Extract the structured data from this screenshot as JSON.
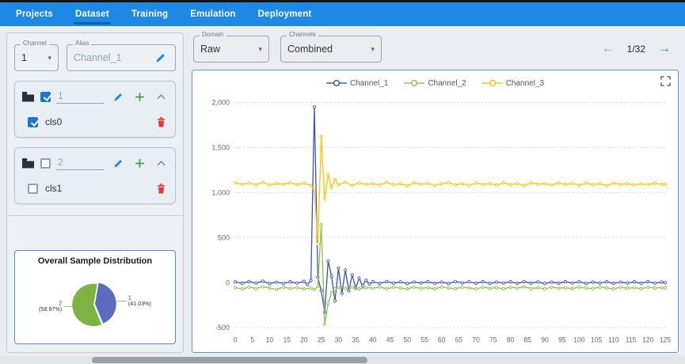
{
  "nav": {
    "tabs": [
      {
        "label": "Projects"
      },
      {
        "label": "Dataset"
      },
      {
        "label": "Training"
      },
      {
        "label": "Emulation"
      },
      {
        "label": "Deployment"
      }
    ],
    "active_tab": "Dataset"
  },
  "icons": {
    "caret": "▾",
    "arrow_left": "←",
    "arrow_right": "→"
  },
  "colors": {
    "nav_bg": "#1e88e5",
    "accent": "#1e88e5",
    "danger": "#e53935",
    "channel1": "#3f51b5",
    "channel2": "#8bc34a",
    "channel3": "#ffc107"
  },
  "left_panel": {
    "channel_field": {
      "label": "Channel",
      "value": "1"
    },
    "alias_field": {
      "label": "Alias",
      "value": "Channel_1"
    },
    "groups": [
      {
        "name": "1",
        "checked": true,
        "items": [
          {
            "label": "cls0",
            "checked": true
          }
        ]
      },
      {
        "name": "2",
        "checked": false,
        "items": [
          {
            "label": "cls1",
            "checked": false
          }
        ]
      }
    ],
    "distribution": {
      "title": "Overall Sample Distribution",
      "slices": [
        {
          "label": "1",
          "pct_label": "(41.03%)",
          "value": 41.03,
          "color": "#5c6bc0"
        },
        {
          "label": "2",
          "pct_label": "(58.97%)",
          "value": 58.97,
          "color": "#7cb342"
        }
      ]
    }
  },
  "toolbar": {
    "domain_field": {
      "label": "Domain",
      "value": "Raw"
    },
    "channels_field": {
      "label": "Channels",
      "value": "Combined"
    },
    "pager": {
      "text": "1/32"
    }
  },
  "chart_data": {
    "type": "line",
    "title": "",
    "xlabel": "",
    "ylabel": "",
    "xlim": [
      0,
      125
    ],
    "ylim": [
      -500,
      2000
    ],
    "yticks": [
      -500,
      0,
      500,
      1000,
      1500,
      2000
    ],
    "xtick_step": 5,
    "grid": "horizontal-dashed",
    "legend_position": "top-center",
    "series": [
      {
        "name": "Channel_1",
        "color": "#3f51b5",
        "points": [
          [
            0,
            8
          ],
          [
            2,
            -6
          ],
          [
            4,
            12
          ],
          [
            6,
            -4
          ],
          [
            8,
            15
          ],
          [
            10,
            -10
          ],
          [
            12,
            5
          ],
          [
            14,
            -8
          ],
          [
            16,
            10
          ],
          [
            18,
            -5
          ],
          [
            20,
            14
          ],
          [
            21,
            -20
          ],
          [
            22,
            25
          ],
          [
            23,
            1950
          ],
          [
            24,
            60
          ],
          [
            25,
            -90
          ],
          [
            26,
            -330
          ],
          [
            27,
            240
          ],
          [
            28,
            70
          ],
          [
            29,
            -200
          ],
          [
            30,
            160
          ],
          [
            31,
            -120
          ],
          [
            32,
            140
          ],
          [
            33,
            -90
          ],
          [
            34,
            85
          ],
          [
            35,
            -60
          ],
          [
            36,
            50
          ],
          [
            37,
            -35
          ],
          [
            38,
            25
          ],
          [
            39,
            -15
          ],
          [
            40,
            10
          ],
          [
            42,
            -8
          ],
          [
            44,
            12
          ],
          [
            46,
            -5
          ],
          [
            48,
            8
          ],
          [
            50,
            -10
          ],
          [
            52,
            6
          ],
          [
            54,
            -4
          ],
          [
            56,
            10
          ],
          [
            58,
            -7
          ],
          [
            60,
            5
          ],
          [
            62,
            -9
          ],
          [
            64,
            12
          ],
          [
            66,
            -4
          ],
          [
            68,
            8
          ],
          [
            70,
            -6
          ],
          [
            72,
            10
          ],
          [
            74,
            -8
          ],
          [
            76,
            5
          ],
          [
            78,
            -4
          ],
          [
            80,
            9
          ],
          [
            82,
            -7
          ],
          [
            84,
            12
          ],
          [
            86,
            -5
          ],
          [
            88,
            7
          ],
          [
            90,
            -9
          ],
          [
            92,
            5
          ],
          [
            94,
            -6
          ],
          [
            96,
            10
          ],
          [
            98,
            -4
          ],
          [
            100,
            8
          ],
          [
            102,
            -8
          ],
          [
            104,
            6
          ],
          [
            106,
            -5
          ],
          [
            108,
            9
          ],
          [
            110,
            -7
          ],
          [
            112,
            5
          ],
          [
            114,
            -4
          ],
          [
            116,
            8
          ],
          [
            118,
            -6
          ],
          [
            120,
            10
          ],
          [
            122,
            -5
          ],
          [
            124,
            6
          ],
          [
            125,
            0
          ]
        ]
      },
      {
        "name": "Channel_2",
        "color": "#8bc34a",
        "points": [
          [
            0,
            -55
          ],
          [
            2,
            -70
          ],
          [
            4,
            -50
          ],
          [
            6,
            -65
          ],
          [
            8,
            -45
          ],
          [
            10,
            -60
          ],
          [
            12,
            -75
          ],
          [
            14,
            -50
          ],
          [
            16,
            -65
          ],
          [
            18,
            -55
          ],
          [
            20,
            -70
          ],
          [
            22,
            -60
          ],
          [
            23,
            -80
          ],
          [
            24,
            -40
          ],
          [
            25,
            640
          ],
          [
            26,
            -460
          ],
          [
            27,
            -230
          ],
          [
            28,
            -110
          ],
          [
            29,
            -70
          ],
          [
            30,
            -55
          ],
          [
            32,
            -65
          ],
          [
            34,
            -50
          ],
          [
            36,
            -70
          ],
          [
            38,
            -55
          ],
          [
            40,
            -62
          ],
          [
            42,
            -48
          ],
          [
            44,
            -68
          ],
          [
            46,
            -52
          ],
          [
            48,
            -60
          ],
          [
            50,
            -70
          ],
          [
            52,
            -50
          ],
          [
            54,
            -64
          ],
          [
            56,
            -55
          ],
          [
            58,
            -70
          ],
          [
            60,
            -48
          ],
          [
            62,
            -60
          ],
          [
            64,
            -66
          ],
          [
            66,
            -52
          ],
          [
            68,
            -58
          ],
          [
            70,
            -70
          ],
          [
            72,
            -50
          ],
          [
            74,
            -64
          ],
          [
            76,
            -55
          ],
          [
            78,
            -68
          ],
          [
            80,
            -52
          ],
          [
            82,
            -60
          ],
          [
            84,
            -45
          ],
          [
            86,
            -66
          ],
          [
            88,
            -55
          ],
          [
            90,
            -70
          ],
          [
            92,
            -50
          ],
          [
            94,
            -62
          ],
          [
            96,
            -56
          ],
          [
            98,
            -68
          ],
          [
            100,
            -48
          ],
          [
            102,
            -60
          ],
          [
            104,
            -65
          ],
          [
            106,
            -52
          ],
          [
            108,
            -58
          ],
          [
            110,
            -70
          ],
          [
            112,
            -50
          ],
          [
            114,
            -63
          ],
          [
            116,
            -55
          ],
          [
            118,
            -67
          ],
          [
            120,
            -52
          ],
          [
            122,
            -60
          ],
          [
            124,
            -56
          ],
          [
            125,
            -58
          ]
        ]
      },
      {
        "name": "Channel_3",
        "color": "#ffc107",
        "points": [
          [
            0,
            1110
          ],
          [
            2,
            1090
          ],
          [
            4,
            1105
          ],
          [
            6,
            1088
          ],
          [
            8,
            1112
          ],
          [
            10,
            1085
          ],
          [
            12,
            1100
          ],
          [
            14,
            1092
          ],
          [
            16,
            1108
          ],
          [
            18,
            1090
          ],
          [
            20,
            1102
          ],
          [
            22,
            1078
          ],
          [
            23,
            1035
          ],
          [
            24,
            430
          ],
          [
            25,
            1620
          ],
          [
            26,
            930
          ],
          [
            27,
            1200
          ],
          [
            28,
            1055
          ],
          [
            29,
            1145
          ],
          [
            30,
            1085
          ],
          [
            32,
            1115
          ],
          [
            34,
            1078
          ],
          [
            36,
            1105
          ],
          [
            38,
            1090
          ],
          [
            40,
            1100
          ],
          [
            42,
            1082
          ],
          [
            44,
            1112
          ],
          [
            46,
            1088
          ],
          [
            48,
            1098
          ],
          [
            50,
            1075
          ],
          [
            52,
            1108
          ],
          [
            54,
            1092
          ],
          [
            56,
            1102
          ],
          [
            58,
            1080
          ],
          [
            60,
            1098
          ],
          [
            62,
            1110
          ],
          [
            64,
            1086
          ],
          [
            66,
            1100
          ],
          [
            68,
            1078
          ],
          [
            70,
            1106
          ],
          [
            72,
            1090
          ],
          [
            74,
            1098
          ],
          [
            76,
            1082
          ],
          [
            78,
            1108
          ],
          [
            80,
            1088
          ],
          [
            82,
            1100
          ],
          [
            84,
            1075
          ],
          [
            86,
            1110
          ],
          [
            88,
            1092
          ],
          [
            90,
            1098
          ],
          [
            92,
            1084
          ],
          [
            94,
            1106
          ],
          [
            96,
            1090
          ],
          [
            98,
            1100
          ],
          [
            100,
            1080
          ],
          [
            102,
            1104
          ],
          [
            104,
            1088
          ],
          [
            106,
            1098
          ],
          [
            108,
            1076
          ],
          [
            110,
            1106
          ],
          [
            112,
            1090
          ],
          [
            114,
            1100
          ],
          [
            116,
            1084
          ],
          [
            118,
            1096
          ],
          [
            120,
            1088
          ],
          [
            122,
            1102
          ],
          [
            124,
            1090
          ],
          [
            125,
            1094
          ]
        ]
      }
    ]
  }
}
